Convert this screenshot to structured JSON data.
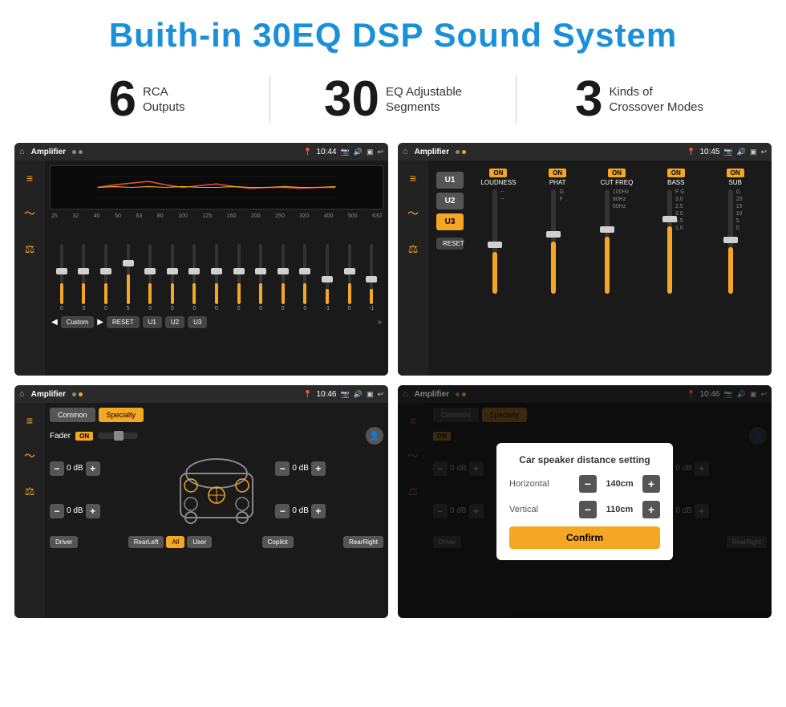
{
  "page": {
    "title": "Buith-in 30EQ DSP Sound System",
    "stats": [
      {
        "number": "6",
        "line1": "RCA",
        "line2": "Outputs"
      },
      {
        "number": "30",
        "line1": "EQ Adjustable",
        "line2": "Segments"
      },
      {
        "number": "3",
        "line1": "Kinds of",
        "line2": "Crossover Modes"
      }
    ],
    "screens": [
      {
        "id": "eq-screen",
        "statusBar": {
          "appName": "Amplifier",
          "time": "10:44"
        },
        "freqLabels": [
          "25",
          "32",
          "40",
          "50",
          "63",
          "80",
          "100",
          "125",
          "160",
          "200",
          "250",
          "320",
          "400",
          "500",
          "630"
        ],
        "sliderValues": [
          "0",
          "0",
          "0",
          "5",
          "0",
          "0",
          "0",
          "0",
          "0",
          "0",
          "0",
          "0",
          "-1",
          "0",
          "-1"
        ],
        "bottomBtns": [
          "Custom",
          "RESET",
          "U1",
          "U2",
          "U3"
        ]
      },
      {
        "id": "crossover-screen",
        "statusBar": {
          "appName": "Amplifier",
          "time": "10:45"
        },
        "presets": [
          "U1",
          "U2",
          "U3"
        ],
        "controls": [
          {
            "on": true,
            "label": "LOUDNESS"
          },
          {
            "on": true,
            "label": "PHAT"
          },
          {
            "on": true,
            "label": "CUT FREQ"
          },
          {
            "on": true,
            "label": "BASS"
          },
          {
            "on": true,
            "label": "SUB"
          }
        ],
        "resetLabel": "RESET"
      },
      {
        "id": "fader-screen",
        "statusBar": {
          "appName": "Amplifier",
          "time": "10:46"
        },
        "tabs": [
          "Common",
          "Specialty"
        ],
        "faderLabel": "Fader",
        "onLabel": "ON",
        "volControls": [
          {
            "label": "0 dB",
            "side": "left-top"
          },
          {
            "label": "0 dB",
            "side": "left-bottom"
          },
          {
            "label": "0 dB",
            "side": "right-top"
          },
          {
            "label": "0 dB",
            "side": "right-bottom"
          }
        ],
        "zoneBtns": [
          "Driver",
          "RearLeft",
          "All",
          "User",
          "RearRight",
          "Copilot"
        ]
      },
      {
        "id": "distance-screen",
        "statusBar": {
          "appName": "Amplifier",
          "time": "10:46"
        },
        "tabs": [
          "Common",
          "Specialty"
        ],
        "dialog": {
          "title": "Car speaker distance setting",
          "rows": [
            {
              "label": "Horizontal",
              "value": "140cm"
            },
            {
              "label": "Vertical",
              "value": "110cm"
            }
          ],
          "confirmLabel": "Confirm"
        }
      }
    ]
  }
}
